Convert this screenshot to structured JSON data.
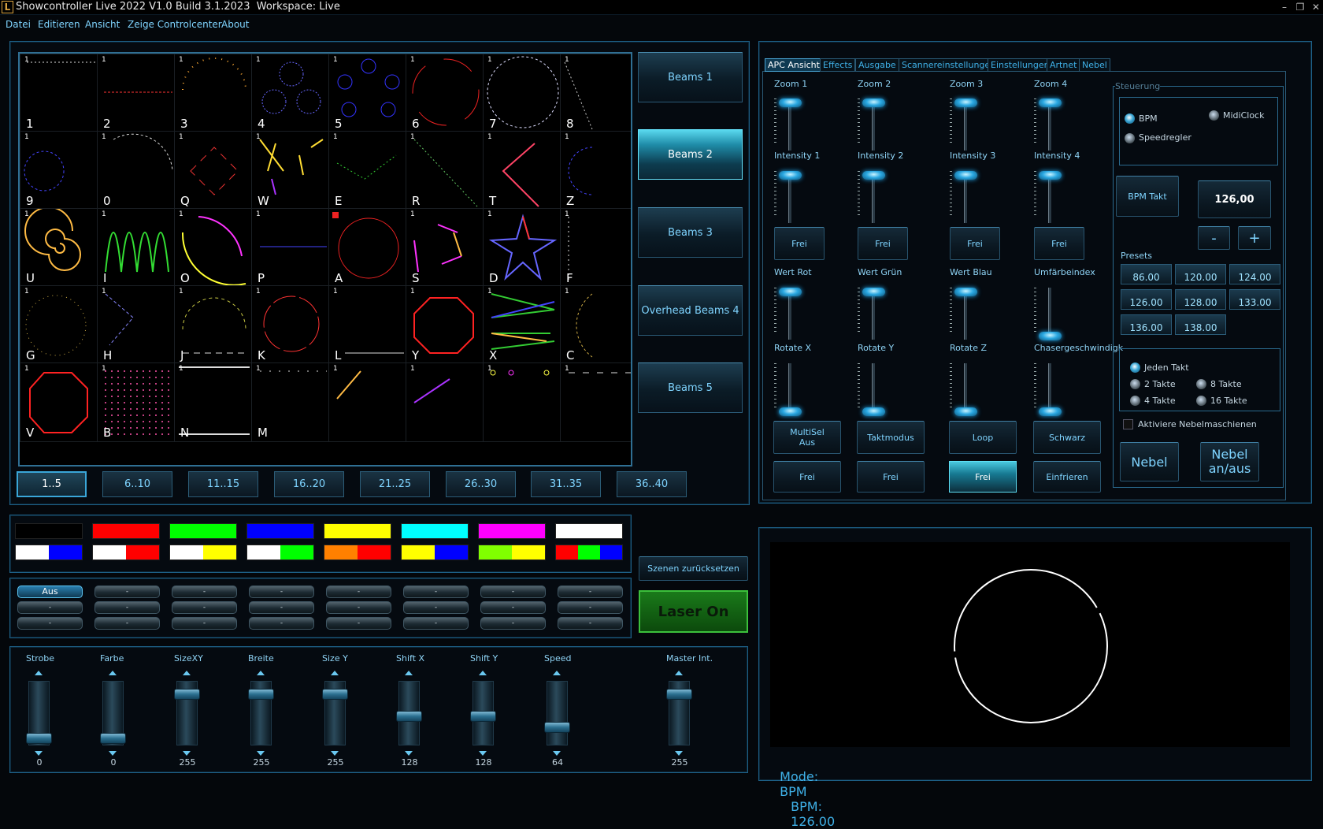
{
  "title_bar": {
    "app_icon": "L",
    "title": "Showcontroller Live 2022 V1.0 Build 3.1.2023  Workspace: Live",
    "min": "–",
    "max": "❐",
    "close": "✕"
  },
  "menu": [
    "Datei",
    "Editieren",
    "Ansicht",
    "Zeige Controlcenter",
    "About"
  ],
  "grid": {
    "tiles": [
      {
        "num": "1",
        "key": "1"
      },
      {
        "num": "1",
        "key": "2"
      },
      {
        "num": "1",
        "key": "3"
      },
      {
        "num": "1",
        "key": "4"
      },
      {
        "num": "1",
        "key": "5"
      },
      {
        "num": "1",
        "key": "6"
      },
      {
        "num": "1",
        "key": "7"
      },
      {
        "num": "1",
        "key": "8"
      },
      {
        "num": "1",
        "key": "9"
      },
      {
        "num": "1",
        "key": "0"
      },
      {
        "num": "1",
        "key": "Q"
      },
      {
        "num": "1",
        "key": "W"
      },
      {
        "num": "1",
        "key": "E"
      },
      {
        "num": "1",
        "key": "R"
      },
      {
        "num": "1",
        "key": "T"
      },
      {
        "num": "1",
        "key": "Z"
      },
      {
        "num": "1",
        "key": "U"
      },
      {
        "num": "1",
        "key": "I"
      },
      {
        "num": "1",
        "key": "O"
      },
      {
        "num": "1",
        "key": "P"
      },
      {
        "num": "",
        "key": "A"
      },
      {
        "num": "1",
        "key": "S"
      },
      {
        "num": "1",
        "key": "D"
      },
      {
        "num": "1",
        "key": "F"
      },
      {
        "num": "1",
        "key": "G"
      },
      {
        "num": "1",
        "key": "H"
      },
      {
        "num": "1",
        "key": "J"
      },
      {
        "num": "1",
        "key": "K"
      },
      {
        "num": "1",
        "key": "L"
      },
      {
        "num": "1",
        "key": "Y"
      },
      {
        "num": "1",
        "key": "X"
      },
      {
        "num": "1",
        "key": "C"
      },
      {
        "num": "1",
        "key": "V"
      },
      {
        "num": "1",
        "key": "B"
      },
      {
        "num": "1",
        "key": "N"
      },
      {
        "num": "1",
        "key": "M"
      },
      {
        "num": "1",
        "key": ""
      },
      {
        "num": "1",
        "key": ""
      },
      {
        "num": "1",
        "key": ""
      },
      {
        "num": "1",
        "key": ""
      }
    ]
  },
  "beam_buttons": [
    "Beams 1",
    "Beams 2",
    "Beams 3",
    "Overhead Beams 4",
    "Beams 5"
  ],
  "page_buttons": [
    "1..5",
    "6..10",
    "11..15",
    "16..20",
    "21..25",
    "26..30",
    "31..35",
    "36..40"
  ],
  "color_swatches": [
    [
      "#000000"
    ],
    [
      "#ff0000"
    ],
    [
      "#00ff00"
    ],
    [
      "#0000ff"
    ],
    [
      "#ffff00"
    ],
    [
      "#00ffff"
    ],
    [
      "#ff00ff"
    ],
    [
      "#ffffff"
    ],
    [
      "#ffffff",
      "#0000ff"
    ],
    [
      "#ffffff",
      "#ff0000"
    ],
    [
      "#ffffff",
      "#ffff00"
    ],
    [
      "#ffffff",
      "#00ff00"
    ],
    [
      "#ff8000",
      "#ff0000"
    ],
    [
      "#ffff00",
      "#0000ff"
    ],
    [
      "#80ff00",
      "#ffff00"
    ],
    [
      "#ff0000",
      "#00ff00",
      "#0000ff"
    ]
  ],
  "scenes": {
    "first": "Aus",
    "placeholder": "-",
    "reset": "Szenen zurücksetzen",
    "laser": "Laser On"
  },
  "faders": [
    {
      "label": "Strobe",
      "value": "0",
      "level": 0.0
    },
    {
      "label": "Farbe",
      "value": "0",
      "level": 0.0
    },
    {
      "label": "SizeXY",
      "value": "255",
      "level": 1.0
    },
    {
      "label": "Breite",
      "value": "255",
      "level": 1.0
    },
    {
      "label": "Size Y",
      "value": "255",
      "level": 1.0
    },
    {
      "label": "Shift X",
      "value": "128",
      "level": 0.5
    },
    {
      "label": "Shift Y",
      "value": "128",
      "level": 0.5
    },
    {
      "label": "Speed",
      "value": "64",
      "level": 0.25
    },
    {
      "label": "Master Int.",
      "value": "255",
      "level": 1.0
    }
  ],
  "tabs": [
    "APC Ansicht",
    "Effects",
    "Ausgabe",
    "Scannereinstellungen",
    "Einstellungen",
    "Artnet",
    "Nebel"
  ],
  "apc": {
    "row1_labels": [
      "Zoom 1",
      "Zoom 2",
      "Zoom 3",
      "Zoom 4"
    ],
    "row2_labels": [
      "Intensity 1",
      "Intensity 2",
      "Intensity 3",
      "Intensity 4"
    ],
    "frei_buttons": [
      "Frei",
      "Frei",
      "Frei",
      "Frei"
    ],
    "row3_labels": [
      "Wert Rot",
      "Wert Grün",
      "Wert Blau",
      "Umfärbeindex"
    ],
    "row4_labels": [
      "Rotate X",
      "Rotate Y",
      "Rotate Z",
      "Chasergeschwindigk"
    ],
    "bottom_row1": [
      "MultiSel\nAus",
      "Taktmodus",
      "Loop",
      "Schwarz"
    ],
    "bottom_row2": [
      "Frei",
      "Frei",
      "Frei",
      "Einfrieren"
    ]
  },
  "steuerung": {
    "group_label": "Steuerung",
    "bpm": "BPM",
    "midi": "MidiClock",
    "speed": "Speedregler",
    "bpm_takt": "BPM Takt",
    "bpm_value": "126,00",
    "minus": "-",
    "plus": "+",
    "presets_label": "Presets",
    "presets": [
      "86.00",
      "120.00",
      "124.00",
      "126.00",
      "128.00",
      "133.00",
      "136.00",
      "138.00"
    ],
    "takt": [
      "Jeden Takt",
      "2 Takte",
      "8 Takte",
      "4 Takte",
      "16 Takte"
    ],
    "nebel_check": "Aktiviere Nebelmaschienen",
    "nebel": "Nebel",
    "nebel_onoff": "Nebel\nan/aus"
  },
  "status": {
    "mode_label": "Mode:",
    "mode": "BPM",
    "bpm_label": "BPM:",
    "bpm": "126.00"
  },
  "colors": {
    "accent": "#3fb1e8",
    "panel_border": "#1d5f86",
    "laser_green": "#1b8a1b"
  }
}
